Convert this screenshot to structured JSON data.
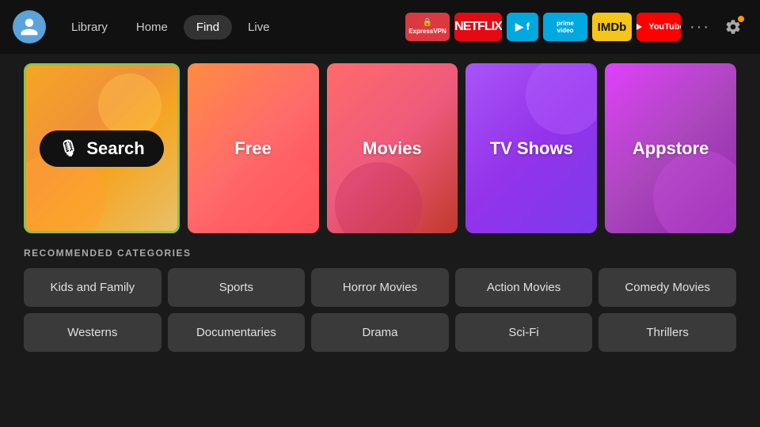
{
  "nav": {
    "tabs": [
      {
        "id": "library",
        "label": "Library",
        "active": false
      },
      {
        "id": "home",
        "label": "Home",
        "active": false
      },
      {
        "id": "find",
        "label": "Find",
        "active": true
      },
      {
        "id": "live",
        "label": "Live",
        "active": false
      }
    ],
    "apps": [
      {
        "id": "expressvpn",
        "label": "ExpressVPN"
      },
      {
        "id": "netflix",
        "label": "NETFLIX"
      },
      {
        "id": "freevee",
        "label": "freevee"
      },
      {
        "id": "primevideo",
        "label": "prime video"
      },
      {
        "id": "imdb",
        "label": "IMDb"
      },
      {
        "id": "youtube",
        "label": "YouTube"
      }
    ]
  },
  "tiles": [
    {
      "id": "search",
      "label": "Search",
      "type": "search"
    },
    {
      "id": "free",
      "label": "Free",
      "type": "free"
    },
    {
      "id": "movies",
      "label": "Movies",
      "type": "movies"
    },
    {
      "id": "tvshows",
      "label": "TV Shows",
      "type": "tvshows"
    },
    {
      "id": "appstore",
      "label": "Appstore",
      "type": "appstore"
    }
  ],
  "recommended": {
    "title": "RECOMMENDED CATEGORIES",
    "categories": [
      {
        "id": "kids",
        "label": "Kids and Family"
      },
      {
        "id": "sports",
        "label": "Sports"
      },
      {
        "id": "horror",
        "label": "Horror Movies"
      },
      {
        "id": "action",
        "label": "Action Movies"
      },
      {
        "id": "comedy",
        "label": "Comedy Movies"
      },
      {
        "id": "westerns",
        "label": "Westerns"
      },
      {
        "id": "documentaries",
        "label": "Documentaries"
      },
      {
        "id": "drama",
        "label": "Drama"
      },
      {
        "id": "scifi",
        "label": "Sci-Fi"
      },
      {
        "id": "thrillers",
        "label": "Thrillers"
      }
    ]
  }
}
